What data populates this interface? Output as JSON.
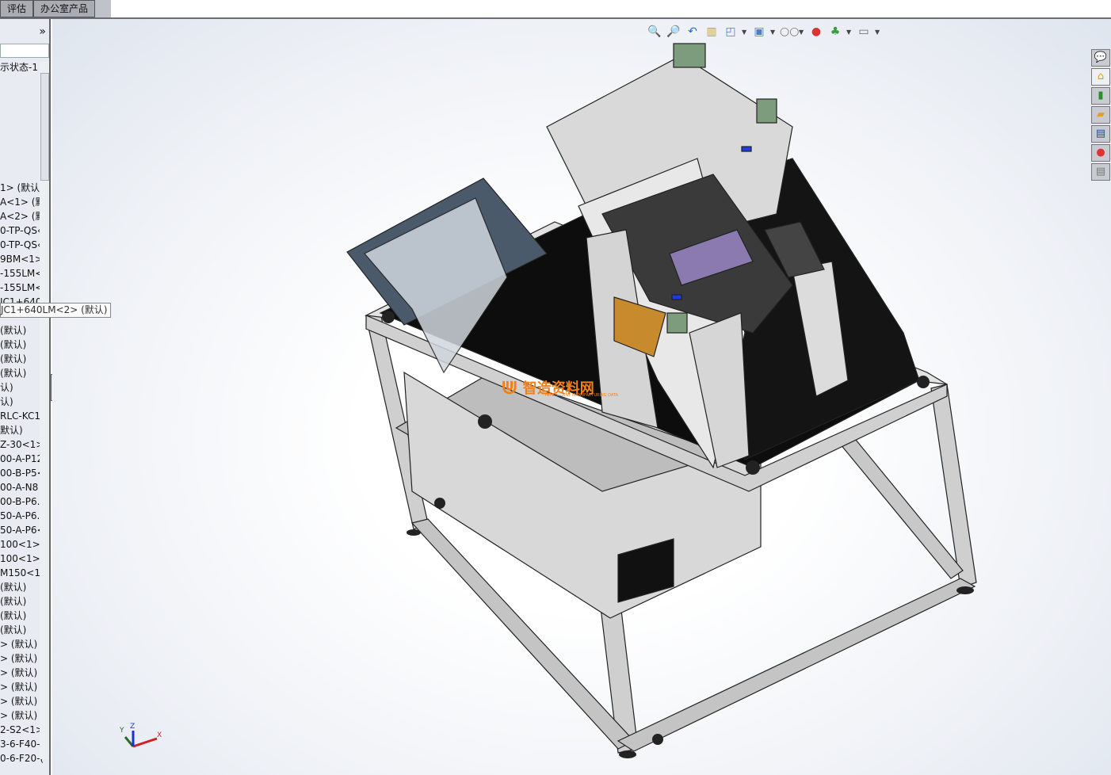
{
  "tabs": [
    "评估",
    "办公室产品"
  ],
  "panel": {
    "expand_label": "»",
    "config_label": "示状态-1",
    "tree_items": [
      "1> (默认",
      "A<1> (默",
      "A<2> (默",
      "0-TP-QS‹",
      "0-TP-QS‹",
      "9BM<1>",
      "-155LM<",
      "-155LM<",
      "JC1+640",
      "",
      "(默认)",
      "(默认)",
      "(默认)",
      "(默认)",
      "认)",
      "认)",
      "RLC-KC1",
      "默认)",
      "Z-30<1>",
      "00-A-P12",
      "00-B-P5<",
      "00-A-N8",
      "00-B-P6.",
      "50-A-P6.",
      "50-A-P6<",
      "100<1>",
      "100<1>",
      "M150<1>",
      "(默认)",
      "(默认)",
      "(默认)",
      "(默认)",
      "> (默认)",
      "> (默认)",
      "> (默认)",
      "> (默认)",
      "> (默认)",
      "> (默认)",
      "2-S2<1>",
      "3-6-F40-(",
      "0-6-F20-("
    ],
    "tooltip": "JC1+640LM<2> (默认)"
  },
  "headsup_toolbar": [
    "zoom-to-fit-icon",
    "zoom-to-area-icon",
    "previous-view-icon",
    "section-view-icon",
    "view-orientation-icon",
    "display-style-icon",
    "hide-show-items-icon",
    "edit-appearance-icon",
    "apply-scene-icon",
    "view-settings-icon"
  ],
  "task_pane": [
    "solidworks-resources-icon",
    "design-library-icon",
    "file-explorer-icon",
    "view-palette-icon",
    "appearances-icon",
    "custom-properties-icon",
    "forum-icon"
  ],
  "triad": {
    "x": "X",
    "y": "Y",
    "z": "Z"
  },
  "watermark": {
    "text": "智造资料网",
    "sub": "INTELLIGENT MANUFACTURING DATA"
  }
}
